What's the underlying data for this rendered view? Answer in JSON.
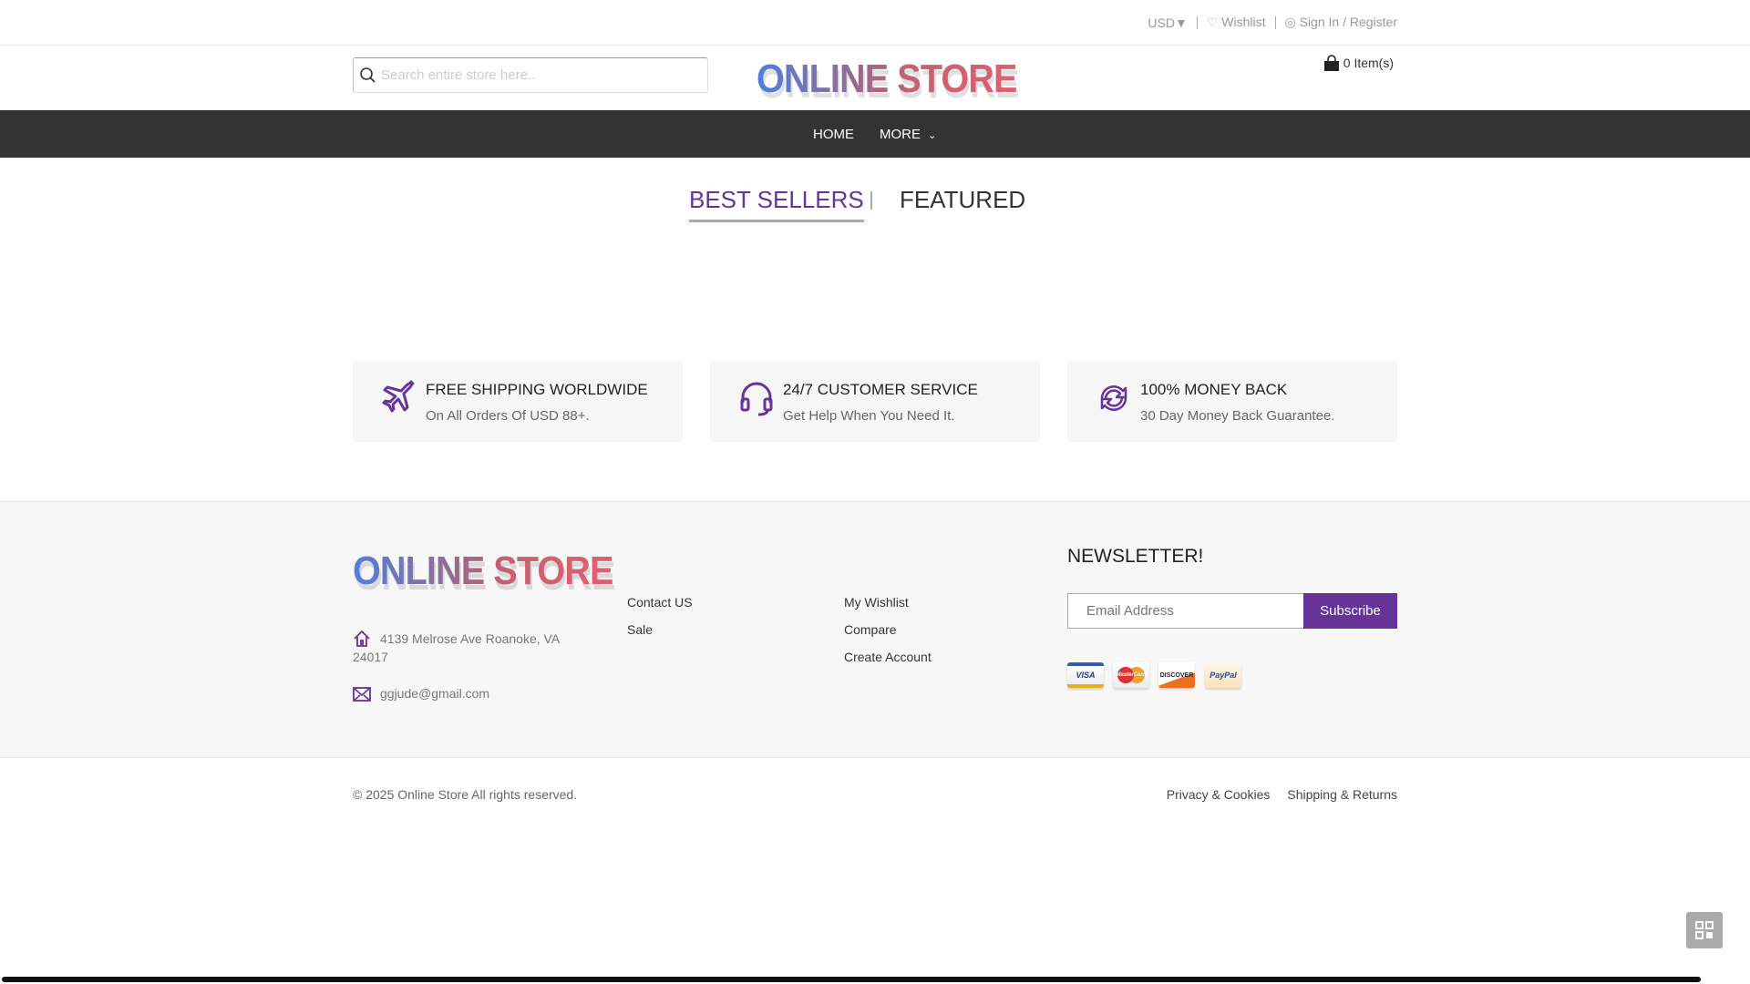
{
  "topbar": {
    "currency": "USD▼",
    "wishlist": "Wishlist",
    "account": "Sign In / Register"
  },
  "header": {
    "search_placeholder": "Search entire store here..",
    "logo": "ONLINE STORE",
    "cart": "0 Item(s)"
  },
  "nav": {
    "items": [
      {
        "label": "HOME"
      },
      {
        "label": "MORE"
      }
    ]
  },
  "tabs": [
    {
      "label": "BEST SELLERS",
      "active": true
    },
    {
      "label": "FEATURED",
      "active": false
    }
  ],
  "features": [
    {
      "icon": "airplane-icon",
      "title": "FREE SHIPPING WORLDWIDE",
      "subtitle": "On All Orders Of USD 88+."
    },
    {
      "icon": "headset-icon",
      "title": "24/7 CUSTOMER SERVICE",
      "subtitle": "Get Help When You Need It."
    },
    {
      "icon": "refresh-icon",
      "title": "100% MONEY BACK",
      "subtitle": "30 Day Money Back Guarantee."
    }
  ],
  "footer": {
    "logo": "ONLINE STORE",
    "address_line1": "4139 Melrose Ave Roanoke, VA",
    "address_line2": "24017",
    "email": "ggjude@gmail.com",
    "links_col1": [
      "Contact US",
      "Sale"
    ],
    "links_col2": [
      "My Wishlist",
      "Compare",
      "Create Account"
    ],
    "newsletter_title": "NEWSLETTER!",
    "email_placeholder": "Email Address",
    "subscribe": "Subscribe",
    "cards": [
      "VISA",
      "MasterCard",
      "DISCOVER",
      "PayPal"
    ],
    "copyright": "© 2025 Online Store All rights reserved.",
    "bottom_links": [
      "Privacy & Cookies",
      "Shipping & Returns"
    ]
  },
  "colors": {
    "accent": "#663399",
    "nav_bg": "#333333",
    "footer_bg": "#f7f7f7"
  }
}
